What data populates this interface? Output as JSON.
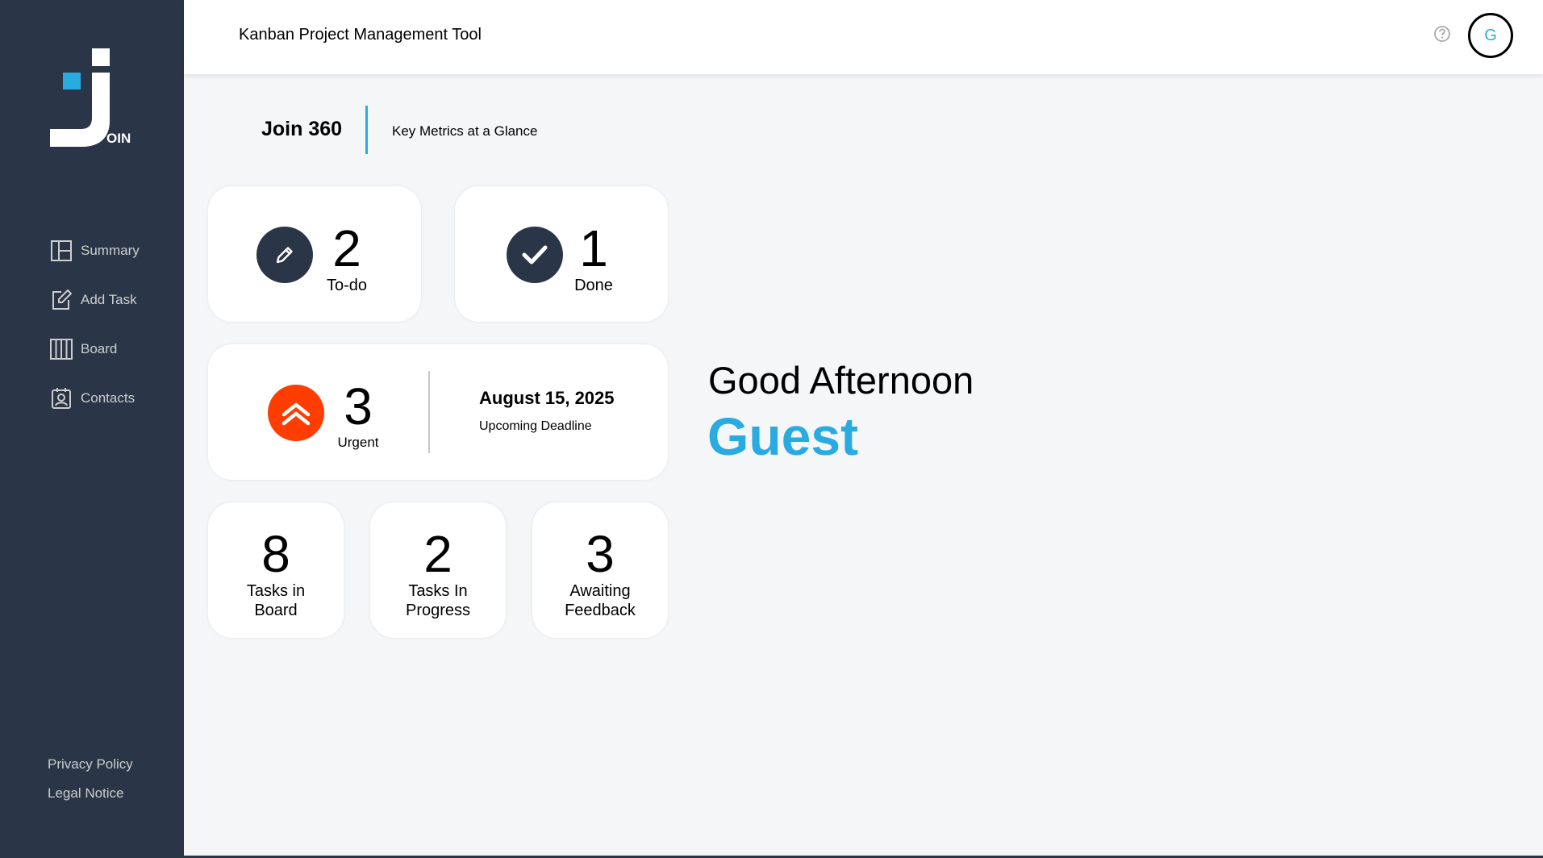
{
  "sidebar": {
    "logo_text": "OIN",
    "items": [
      {
        "label": "Summary",
        "icon": "summary-icon"
      },
      {
        "label": "Add Task",
        "icon": "add-task-icon"
      },
      {
        "label": "Board",
        "icon": "board-icon"
      },
      {
        "label": "Contacts",
        "icon": "contacts-icon"
      }
    ],
    "legal": [
      {
        "label": "Privacy Policy"
      },
      {
        "label": "Legal Notice"
      }
    ]
  },
  "header": {
    "title": "Kanban Project Management Tool",
    "avatar_initial": "G",
    "help_icon": "help-icon"
  },
  "page": {
    "title": "Join 360",
    "subtitle": "Key Metrics at a Glance"
  },
  "metrics": {
    "todo": {
      "count": "2",
      "label": "To-do",
      "icon": "pencil-icon"
    },
    "done": {
      "count": "1",
      "label": "Done",
      "icon": "check-icon"
    },
    "urgent": {
      "count": "3",
      "label": "Urgent",
      "icon": "double-chevron-up-icon",
      "deadline_date": "August 15, 2025",
      "deadline_label": "Upcoming Deadline"
    },
    "board": {
      "count": "8",
      "label_line1": "Tasks in",
      "label_line2": "Board"
    },
    "in_progress": {
      "count": "2",
      "label_line1": "Tasks In",
      "label_line2": "Progress"
    },
    "feedback": {
      "count": "3",
      "label_line1": "Awaiting",
      "label_line2": "Feedback"
    }
  },
  "greeting": {
    "text": "Good Afternoon",
    "name": "Guest"
  },
  "colors": {
    "sidebar_bg": "#2a3647",
    "accent": "#29abe2",
    "urgent": "#ff3d00",
    "page_bg": "#f5f6f8"
  }
}
